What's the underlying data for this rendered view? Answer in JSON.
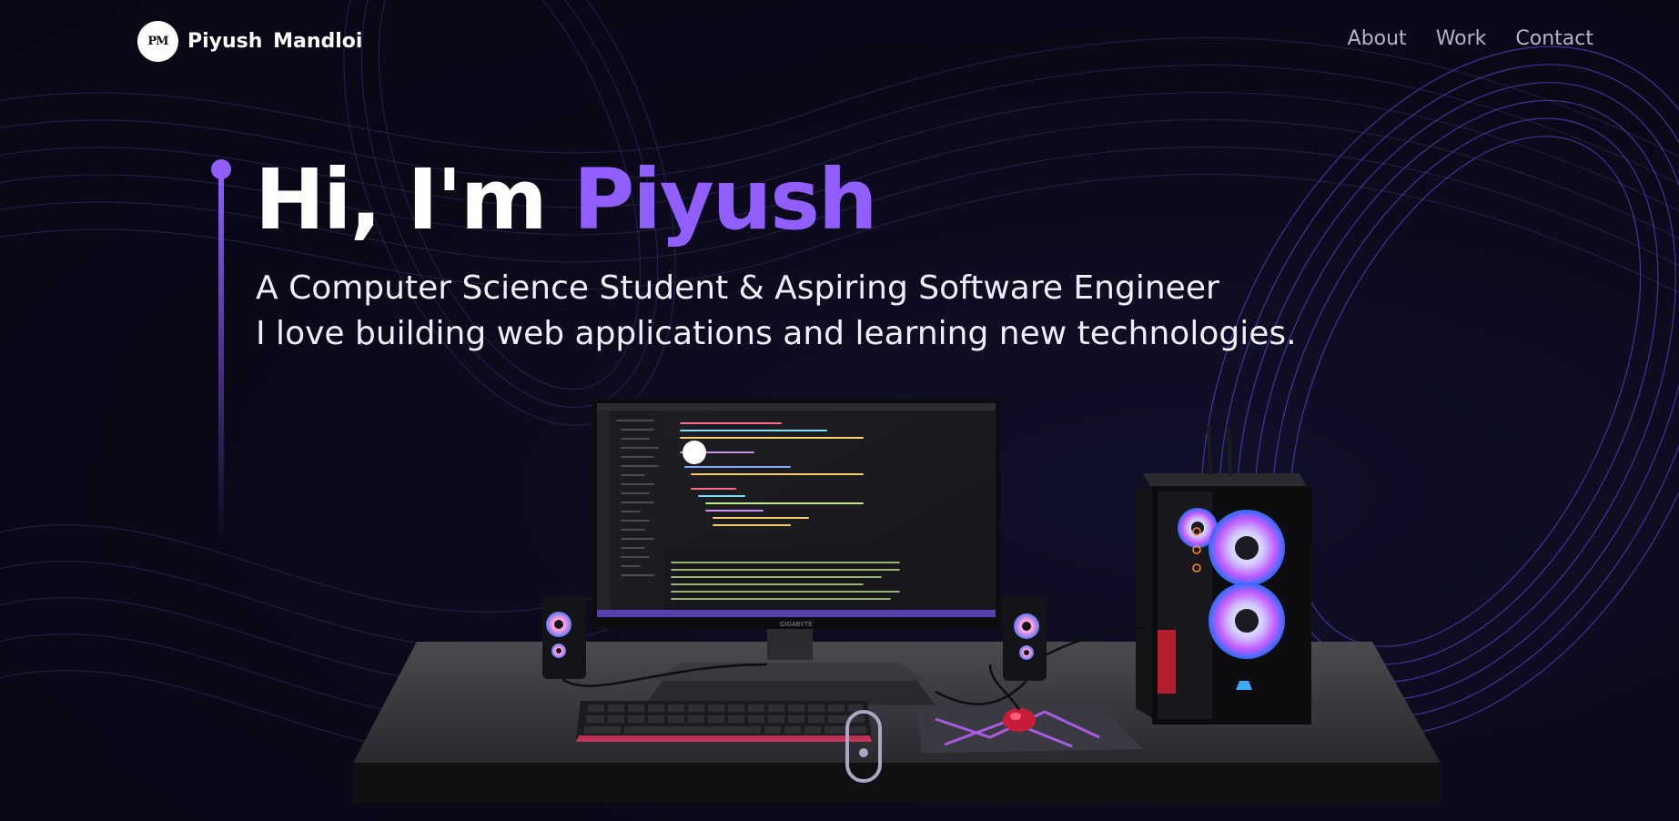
{
  "nav": {
    "logo_initials": "PM",
    "brand_name": "Piyush Mandloi",
    "links": [
      "About",
      "Work",
      "Contact"
    ]
  },
  "hero": {
    "greeting": "Hi, I'm ",
    "name": "Piyush",
    "subtitle_line1": "A Computer Science Student & Aspiring Software Engineer",
    "subtitle_line2": "I love building web applications and learning new technologies."
  },
  "scene": {
    "monitor_brand": "GIGABYTE"
  },
  "colors": {
    "accent": "#915eff",
    "background": "#0b0a1a",
    "text": "#ffffff"
  }
}
